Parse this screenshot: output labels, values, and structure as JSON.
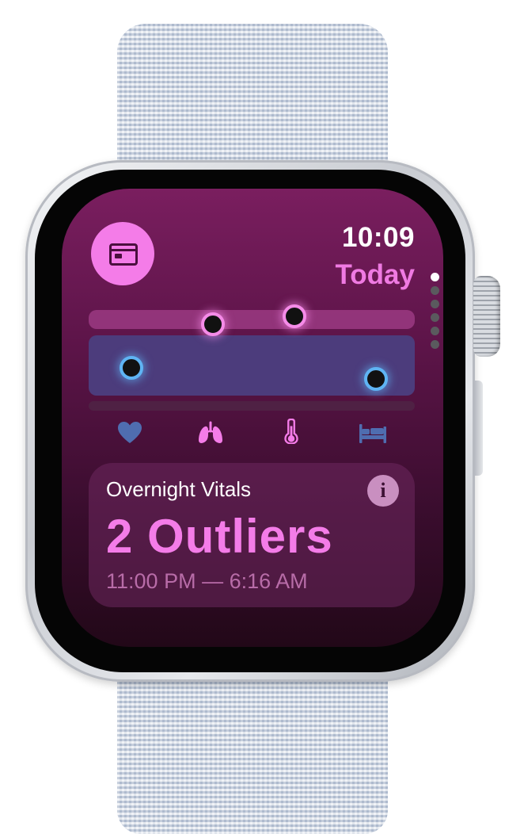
{
  "watch": {
    "time": "10:09",
    "date_label": "Today",
    "app_icon": "vitals-app-icon",
    "vitals_chart": {
      "rows": [
        {
          "name": "top",
          "outlier_points": 2,
          "color": "#f58be8"
        },
        {
          "name": "middle",
          "outlier_points": 2,
          "color": "#5fb4f4"
        },
        {
          "name": "bottom",
          "outlier_points": 0
        }
      ]
    },
    "metric_icons": [
      "heart-icon",
      "lungs-icon",
      "thermometer-icon",
      "bed-icon"
    ],
    "card": {
      "label": "Overnight Vitals",
      "value": "2 Outliers",
      "time_range": "11:00 PM — 6:16 AM",
      "info_icon": "i"
    },
    "page_indicator": {
      "total": 6,
      "active": 0
    },
    "colors": {
      "accent_pink": "#f47ce8",
      "accent_blue": "#5fb4f4",
      "screen_bg": "#5c1448"
    }
  }
}
